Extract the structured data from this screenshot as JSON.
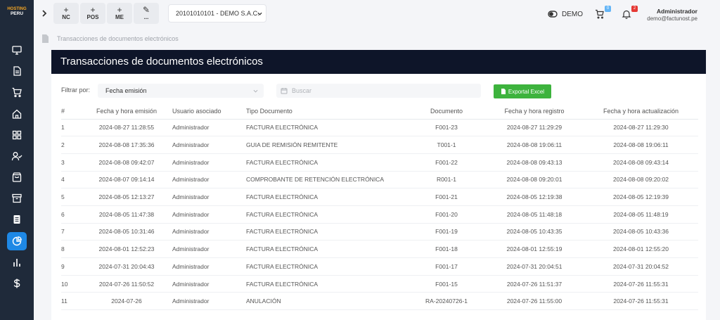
{
  "brand": {
    "line1": "HOSTING",
    "line2": "PERU"
  },
  "sidebar": {
    "icons": [
      "monitor-icon",
      "document-icon",
      "cart-icon",
      "home-icon",
      "grid-icon",
      "user-check-icon",
      "bag-icon",
      "archive-icon",
      "clipboard-icon",
      "pie-chart-icon",
      "bar-chart-icon",
      "dollar-icon"
    ],
    "active_index": 9
  },
  "topbar": {
    "quick_buttons": [
      {
        "plus": "+",
        "label": "NC"
      },
      {
        "plus": "+",
        "label": "POS"
      },
      {
        "plus": "+",
        "label": "ME"
      },
      {
        "plus": "✎",
        "label": "..."
      }
    ],
    "company": "20101010101 - DEMO S.A.C.",
    "demo_label": "DEMO",
    "cart_badge": "0",
    "bell_badge": "2",
    "user_name": "Administrador",
    "user_email": "demo@factunost.pe"
  },
  "breadcrumb": {
    "text": "Transacciones de documentos electrónicos"
  },
  "page": {
    "title": "Transacciones de documentos electrónicos"
  },
  "filters": {
    "label": "Filtrar por:",
    "selected": "Fecha emisión",
    "search_placeholder": "Buscar",
    "export_label": "Exportal Excel"
  },
  "table": {
    "headers": [
      "#",
      "Fecha y hora emisión",
      "Usuario asociado",
      "Tipo Documento",
      "Documento",
      "Fecha y hora registro",
      "Fecha y hora actualización"
    ],
    "rows": [
      [
        "1",
        "2024-08-27 11:28:55",
        "Administrador",
        "FACTURA ELECTRÓNICA",
        "F001-23",
        "2024-08-27 11:29:29",
        "2024-08-27 11:29:30"
      ],
      [
        "2",
        "2024-08-08 17:35:36",
        "Administrador",
        "GUIA DE REMISIÓN REMITENTE",
        "T001-1",
        "2024-08-08 19:06:11",
        "2024-08-08 19:06:11"
      ],
      [
        "3",
        "2024-08-08 09:42:07",
        "Administrador",
        "FACTURA ELECTRÓNICA",
        "F001-22",
        "2024-08-08 09:43:13",
        "2024-08-08 09:43:14"
      ],
      [
        "4",
        "2024-08-07 09:14:14",
        "Administrador",
        "COMPROBANTE DE RETENCIÓN ELECTRÓNICA",
        "R001-1",
        "2024-08-08 09:20:01",
        "2024-08-08 09:20:02"
      ],
      [
        "5",
        "2024-08-05 12:13:27",
        "Administrador",
        "FACTURA ELECTRÓNICA",
        "F001-21",
        "2024-08-05 12:19:38",
        "2024-08-05 12:19:39"
      ],
      [
        "6",
        "2024-08-05 11:47:38",
        "Administrador",
        "FACTURA ELECTRÓNICA",
        "F001-20",
        "2024-08-05 11:48:18",
        "2024-08-05 11:48:19"
      ],
      [
        "7",
        "2024-08-05 10:31:46",
        "Administrador",
        "FACTURA ELECTRÓNICA",
        "F001-19",
        "2024-08-05 10:43:35",
        "2024-08-05 10:43:36"
      ],
      [
        "8",
        "2024-08-01 12:52:23",
        "Administrador",
        "FACTURA ELECTRÓNICA",
        "F001-18",
        "2024-08-01 12:55:19",
        "2024-08-01 12:55:20"
      ],
      [
        "9",
        "2024-07-31 20:04:43",
        "Administrador",
        "FACTURA ELECTRÓNICA",
        "F001-17",
        "2024-07-31 20:04:51",
        "2024-07-31 20:04:52"
      ],
      [
        "10",
        "2024-07-26 11:50:52",
        "Administrador",
        "FACTURA ELECTRÓNICA",
        "F001-15",
        "2024-07-26 11:51:37",
        "2024-07-26 11:55:31"
      ],
      [
        "11",
        "2024-07-26",
        "Administrador",
        "ANULACIÓN",
        "RA-20240726-1",
        "2024-07-26 11:55:00",
        "2024-07-26 11:55:31"
      ]
    ]
  },
  "colors": {
    "sidebar_bg": "#1f2a3a",
    "header_bg": "#0e1529",
    "accent": "#1e88e5",
    "excel_green": "#3db33d",
    "cart_badge": "#64b5f6",
    "bell_badge": "#e53935"
  }
}
